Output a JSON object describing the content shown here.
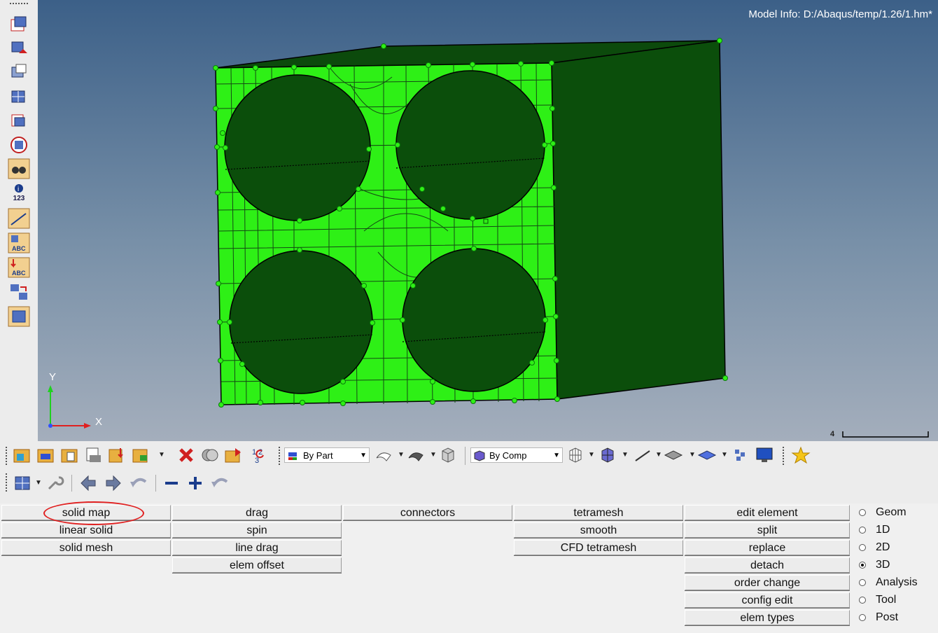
{
  "viewport": {
    "model_info": "Model Info: D:/Abaqus/temp/1.26/1.hm*",
    "axis_y": "Y",
    "axis_x": "X",
    "scale_value": "4"
  },
  "left_toolbar": {
    "info_label": "123",
    "icons": [
      "show-elements-icon",
      "mask-elements-icon",
      "unmask-icon",
      "reverse-icon",
      "find-icon",
      "isolate-icon",
      "binoculars-icon",
      "number-icon",
      "scale-icon",
      "label-abc-icon",
      "label-abc-red-icon",
      "swap-icon",
      "frame-icon"
    ]
  },
  "toolbar": {
    "select_part": "By Part",
    "select_comp": "By Comp"
  },
  "panel": {
    "col1": [
      "solid map",
      "linear solid",
      "solid mesh"
    ],
    "col2": [
      "drag",
      "spin",
      "line drag",
      "elem offset"
    ],
    "col3": [
      "connectors"
    ],
    "col4": [
      "tetramesh",
      "smooth",
      "CFD tetramesh"
    ],
    "col5": [
      "edit element",
      "split",
      "replace",
      "detach",
      "order change",
      "config edit",
      "elem types"
    ],
    "radios": [
      {
        "label": "Geom",
        "selected": false
      },
      {
        "label": "1D",
        "selected": false
      },
      {
        "label": "2D",
        "selected": false
      },
      {
        "label": "3D",
        "selected": true
      },
      {
        "label": "Analysis",
        "selected": false
      },
      {
        "label": "Tool",
        "selected": false
      },
      {
        "label": "Post",
        "selected": false
      }
    ]
  },
  "colors": {
    "mesh_green": "#2ef016",
    "dark_green": "#0b4e0b",
    "annotation_red": "#e02020",
    "bg_top": "#3c6088",
    "bg_bottom": "#a4aebc"
  }
}
